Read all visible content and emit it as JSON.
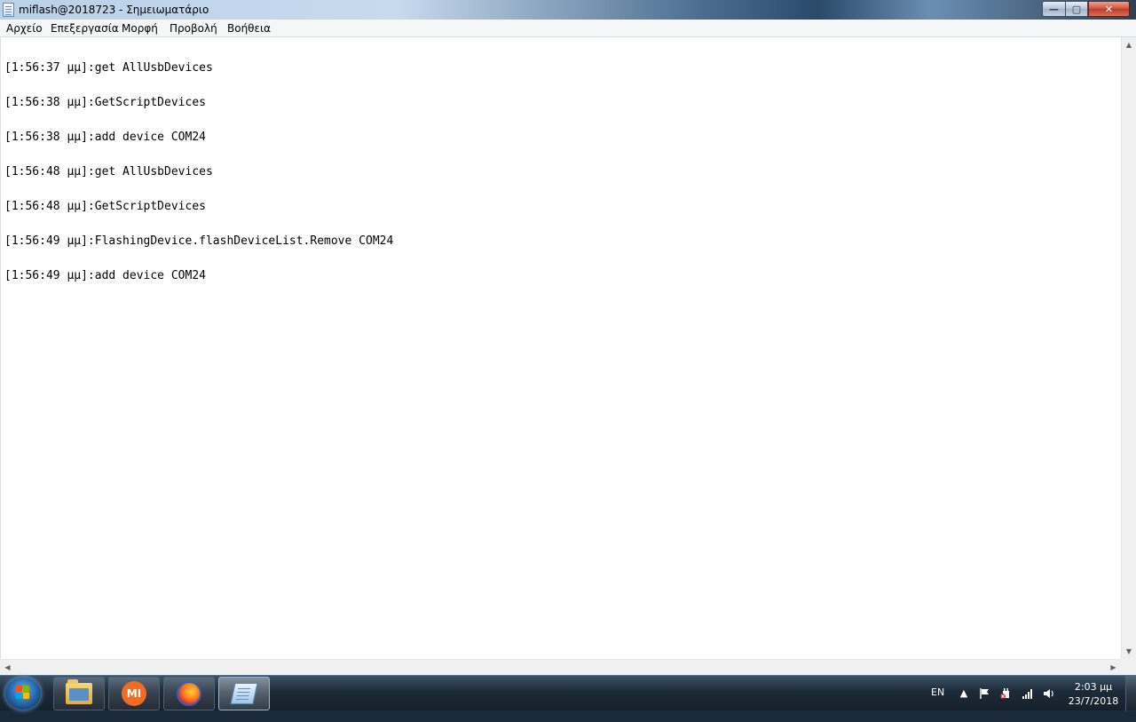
{
  "window": {
    "title": "miflash@2018723 - Σημειωματάριο",
    "controls": {
      "minimize": "—",
      "maximize": "▢",
      "close": "✕"
    }
  },
  "menu": {
    "items": [
      {
        "label": "Αρχείο"
      },
      {
        "label": "Επεξεργασία"
      },
      {
        "label": "Μορφή"
      },
      {
        "label": "Προβολή"
      },
      {
        "label": "Βοήθεια"
      }
    ]
  },
  "editor": {
    "lines": [
      "[1:56:37 μμ]:get AllUsbDevices",
      "[1:56:38 μμ]:GetScriptDevices",
      "[1:56:38 μμ]:add device COM24",
      "[1:56:48 μμ]:get AllUsbDevices",
      "[1:56:48 μμ]:GetScriptDevices",
      "[1:56:49 μμ]:FlashingDevice.flashDeviceList.Remove COM24",
      "[1:56:49 μμ]:add device COM24"
    ]
  },
  "taskbar": {
    "pinned": [
      {
        "name": "windows-explorer",
        "icon": "folder-icon",
        "label": ""
      },
      {
        "name": "miflash",
        "icon": "mi-icon",
        "label": "MI"
      },
      {
        "name": "firefox",
        "icon": "firefox-icon",
        "label": ""
      },
      {
        "name": "notepad",
        "icon": "notepad-icon",
        "label": "",
        "active": true
      }
    ],
    "tray": {
      "language": "EN",
      "show_hidden": "▲",
      "time": "2:03 μμ",
      "date": "23/7/2018"
    }
  }
}
